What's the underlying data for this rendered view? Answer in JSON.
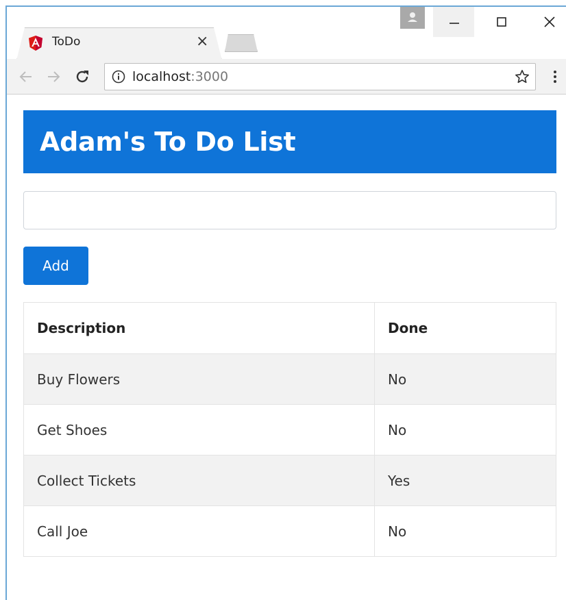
{
  "browser": {
    "tab_title": "ToDo",
    "tab_close": "×",
    "url_host": "localhost",
    "url_port": ":3000"
  },
  "app": {
    "title": "Adam's To Do List",
    "input_value": "",
    "input_placeholder": "",
    "add_label": "Add"
  },
  "table": {
    "headers": [
      "Description",
      "Done"
    ],
    "rows": [
      {
        "description": "Buy Flowers",
        "done": "No"
      },
      {
        "description": "Get Shoes",
        "done": "No"
      },
      {
        "description": "Collect Tickets",
        "done": "Yes"
      },
      {
        "description": "Call Joe",
        "done": "No"
      }
    ]
  },
  "colors": {
    "accent": "#0f74d8",
    "row_stripe": "#f2f2f2",
    "window_border": "#6aa7d6"
  },
  "icons": {
    "favicon": "angular-logo-icon",
    "back": "back-arrow-icon",
    "forward": "forward-arrow-icon",
    "reload": "reload-icon",
    "info": "info-icon",
    "bookmark": "star-icon",
    "menu": "kebab-menu-icon"
  }
}
